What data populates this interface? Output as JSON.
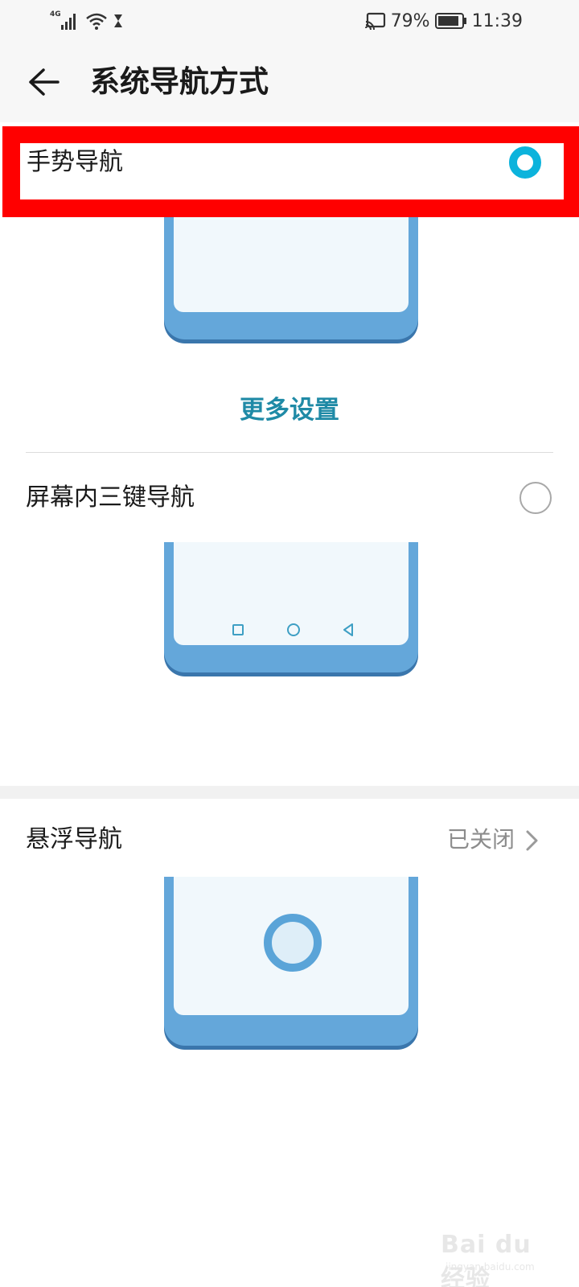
{
  "status_bar": {
    "network": "4G",
    "battery": "79%",
    "time": "11:39"
  },
  "header": {
    "title": "系统导航方式"
  },
  "options": [
    {
      "label": "手势导航",
      "selected": true
    },
    {
      "label": "屏幕内三键导航",
      "selected": false
    }
  ],
  "more_settings": "更多设置",
  "floating_nav": {
    "label": "悬浮导航",
    "status": "已关闭"
  },
  "watermark": {
    "text": "Bai du 经验",
    "sub": "jingyan.baidu.com"
  },
  "colors": {
    "accent": "#0cb3dc",
    "link": "#1f8aa6",
    "highlight": "#ff0000",
    "phone_body": "#64a7da"
  }
}
